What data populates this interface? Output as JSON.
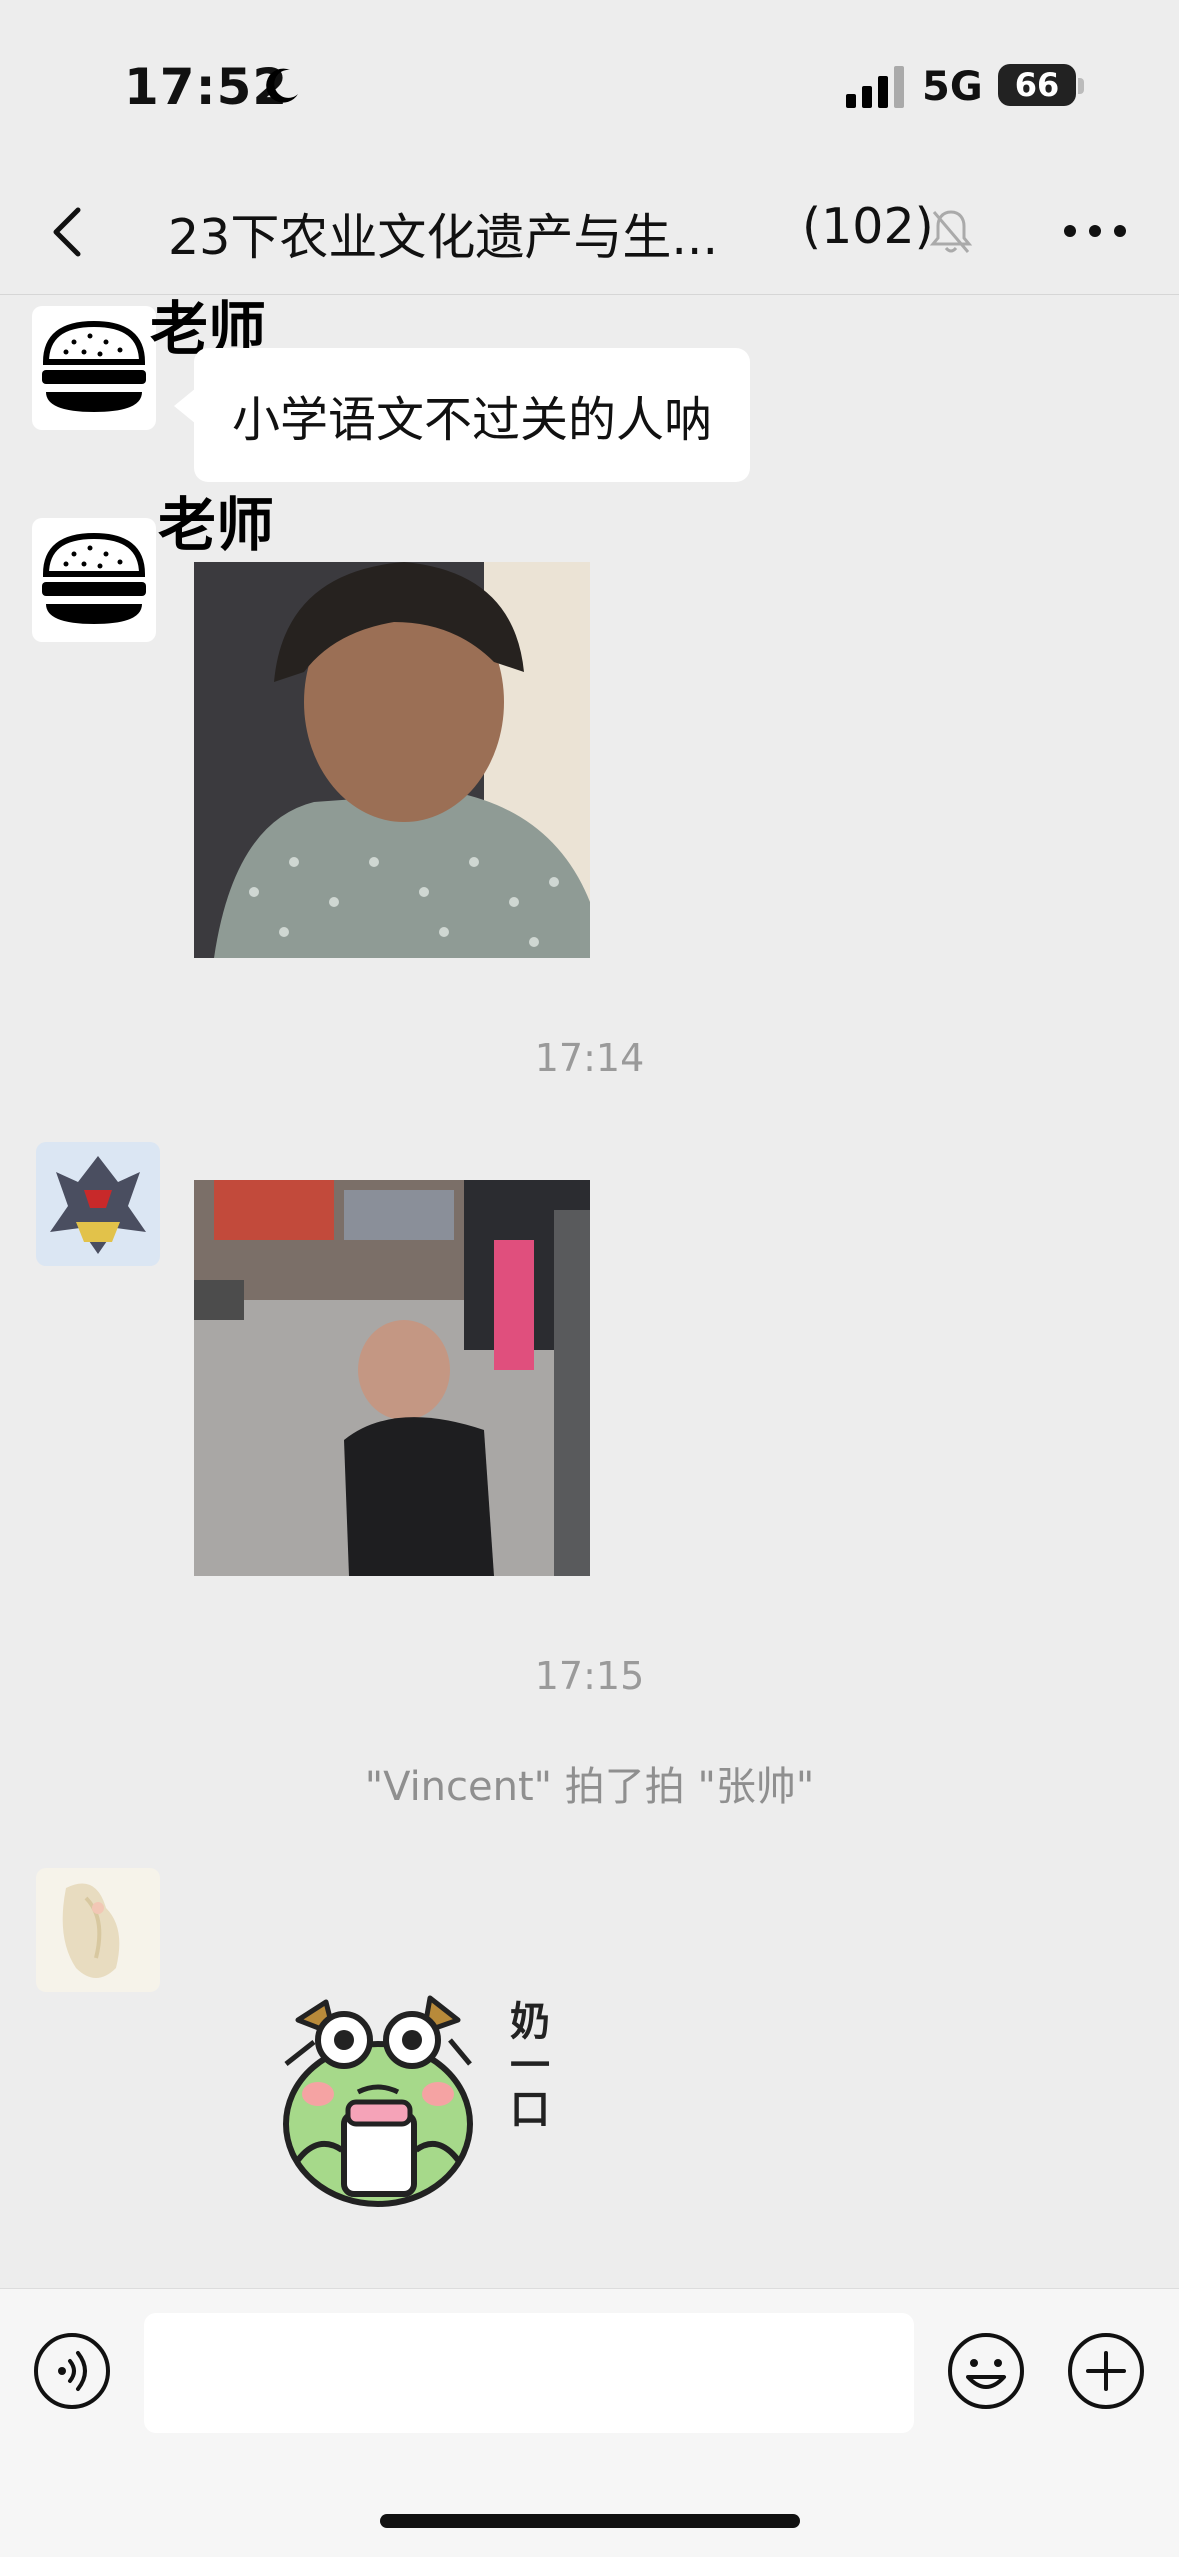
{
  "status": {
    "time": "17:52",
    "network": "5G",
    "battery": "66"
  },
  "header": {
    "title": "23下农业文化遗产与生...",
    "member_count": "(102)"
  },
  "messages": [
    {
      "sender": "老师",
      "text": "小学语文不过关的人呐"
    },
    {
      "sender": "老师"
    }
  ],
  "timestamps": [
    "17:14",
    "17:15"
  ],
  "system_message": "\"Vincent\" 拍了拍 \"张帅\"",
  "sticker": {
    "caption": "奶一口"
  },
  "input": {
    "placeholder": ""
  },
  "icons": [
    "moon-icon",
    "signal-icon",
    "battery-icon",
    "back-icon",
    "mute-bell-icon",
    "more-icon",
    "burger-avatar-icon",
    "voice-icon",
    "emoji-icon",
    "plus-icon"
  ]
}
